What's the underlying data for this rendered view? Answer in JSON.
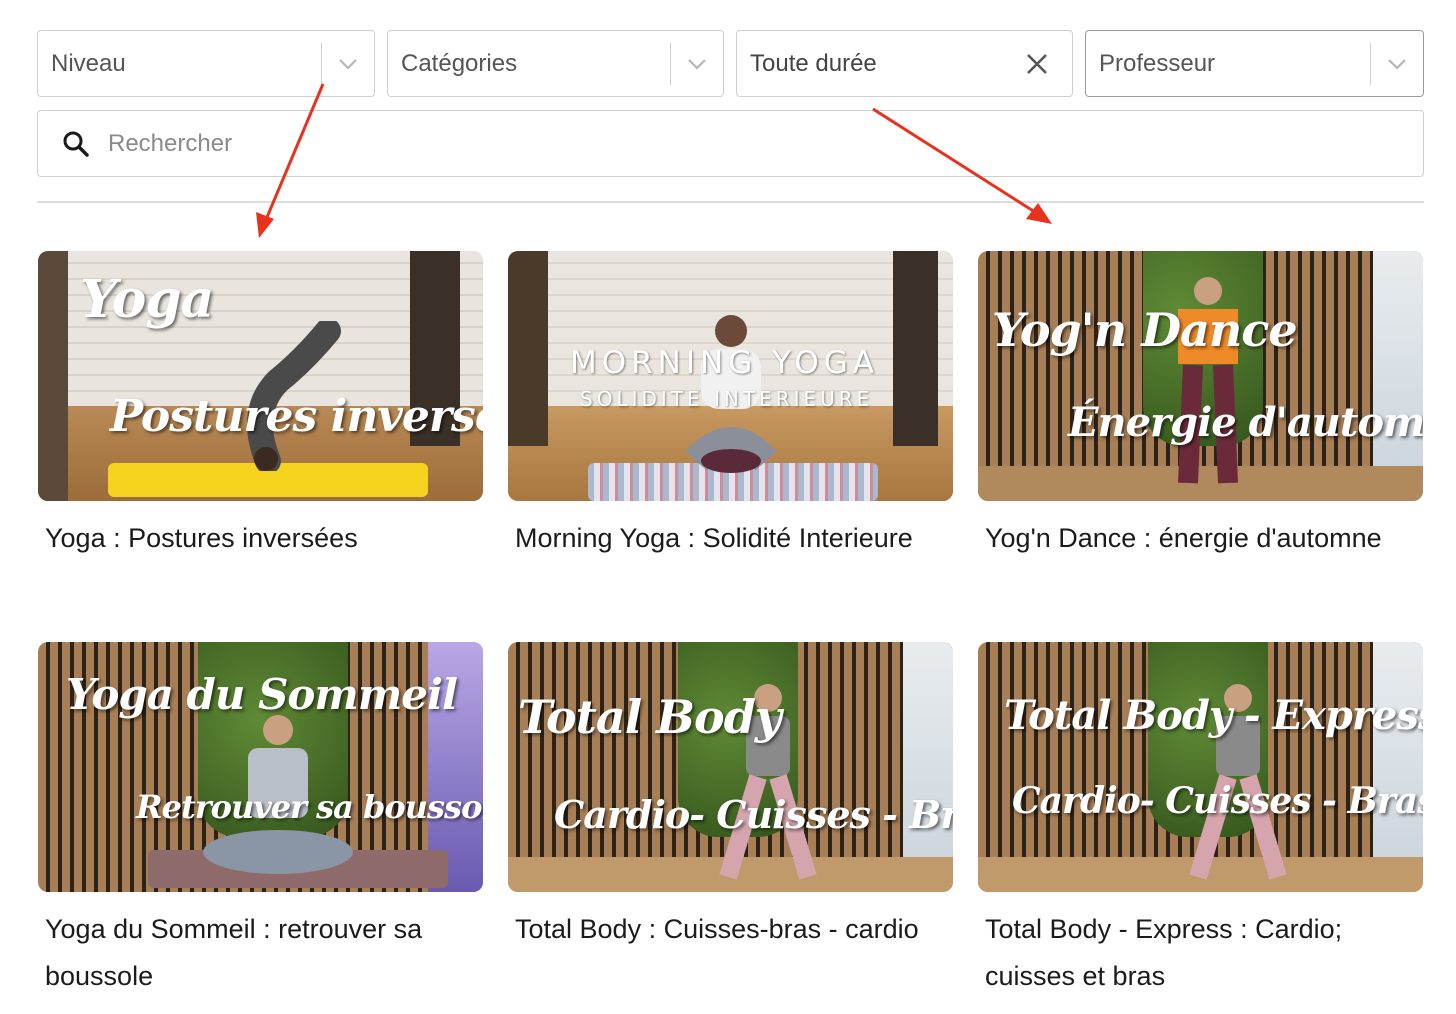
{
  "filters": {
    "level": {
      "label": "Niveau"
    },
    "categories": {
      "label": "Catégories"
    },
    "duration": {
      "label": "Toute durée"
    },
    "teacher": {
      "label": "Professeur"
    }
  },
  "search": {
    "placeholder": "Rechercher"
  },
  "videos": [
    {
      "title": "Yoga : Postures inversées",
      "thumb_line1": "Yoga",
      "thumb_line2": "Postures inverses"
    },
    {
      "title": "Morning Yoga : Solidité Interieure",
      "thumb_line1": "MORNING YOGA",
      "thumb_line2": "SOLIDITE INTERIEURE"
    },
    {
      "title": "Yog'n Dance : énergie d'automne",
      "thumb_line1": "Yog'n Dance",
      "thumb_line2": "Énergie d'automne"
    },
    {
      "title": "Yoga du Sommeil : retrouver sa boussole",
      "thumb_line1": "Yoga du Sommeil",
      "thumb_line2": "Retrouver sa boussole"
    },
    {
      "title": "Total Body : Cuisses-bras - cardio",
      "thumb_line1": "Total Body",
      "thumb_line2": "Cardio- Cuisses - Bras"
    },
    {
      "title": "Total Body - Express : Cardio; cuisses et bras",
      "thumb_line1": "Total Body - Express",
      "thumb_line2": "Cardio- Cuisses - Bras"
    }
  ],
  "colors": {
    "annotation_arrow": "#e8321e",
    "border": "#cfcfcf",
    "placeholder": "#8a8a8a"
  }
}
